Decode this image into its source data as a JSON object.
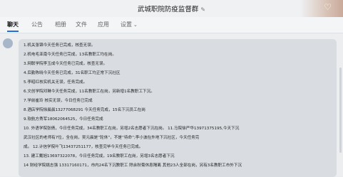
{
  "header": {
    "title": "武城职院防疫监督群"
  },
  "tabs": [
    {
      "label": "聊天"
    },
    {
      "label": "公告"
    },
    {
      "label": "相册"
    },
    {
      "label": "文件"
    },
    {
      "label": "应用"
    },
    {
      "label": "设置"
    }
  ],
  "message": {
    "lines": [
      "1.机关张锦今天任务已完成，核查无误。",
      "2.机电毛亚南今天任务已完成，13名教职工均在岗。",
      "3.网联学院李玉成今天任务已完成，核查无误。",
      "4.后勤陈晓今天任务已完成，31名职工均正常下沉社区",
      "5.李昭红核实机关无误，任务完成。",
      "6.文创学院邓琳今天任务完成，11名教职工在岗，另新增1名教职工下沉。",
      "7.学前崔玲 核实无误，今日任务已完成",
      "8.酒店学院徐晨晨13277068291 今天任务完成，15名下沉员工在岗",
      "9.软航方秀军18062064525，今日任务完成",
      "10. 外语学院张倩，今日任务完成，34名教职工在岗，另增2名志愿者下沉在岗。                 11.马院徐严华13971375195,今天下沉",
      "武汉社区的老师有7位，全在岗，吴元晨是“轮休”，不是“待命”;李小波在外地下沉社区，今天任务完",
      "成。                                                      12.计信学院叶飞13437251177，核查完毕今天任务已完成。",
      "13. 建工戴旭13697322078，今日任务完成，19名教职工在岗，另增3名志愿者下沉",
      "14 财经学院姚志强 13317160171，市内24名下沉教职工 除余秋菊休息隔离 其他23人全部在岗，另有3名教职工市外下沉"
    ]
  }
}
